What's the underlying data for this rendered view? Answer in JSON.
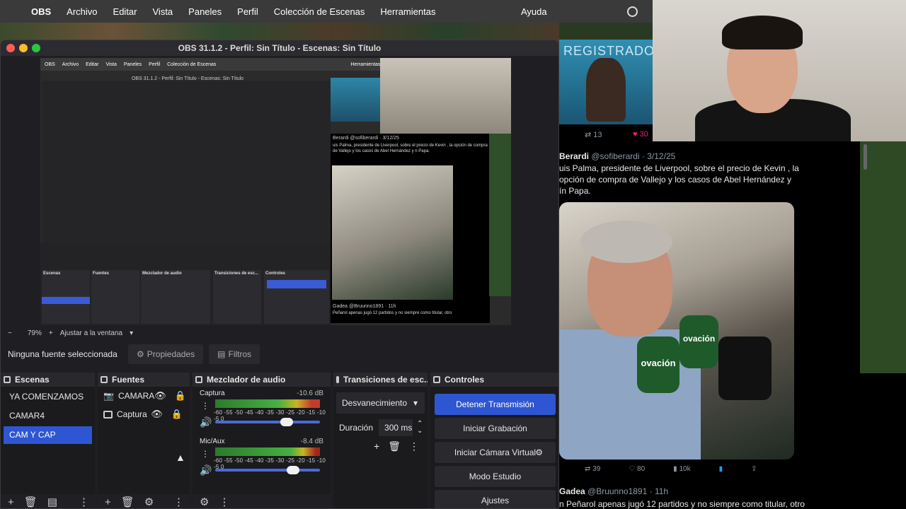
{
  "menubar": {
    "app": "OBS",
    "items": [
      "Archivo",
      "Editar",
      "Vista",
      "Paneles",
      "Perfil",
      "Colección de Escenas",
      "Herramientas"
    ],
    "help": "Ayuda"
  },
  "window": {
    "title": "OBS 31.1.2 - Perfil: Sin Título - Escenas: Sin Título"
  },
  "preview": {
    "menu": [
      "OBS",
      "Archivo",
      "Editar",
      "Vista",
      "Paneles",
      "Perfil",
      "Colección de Escenas",
      "Herramientas",
      "Ayuda"
    ],
    "title": "OBS 31.1.2 - Perfil: Sin Título - Escenas: Sin Título",
    "tweet_name": "Berardi @sofiberardi · 3/12/25",
    "tweet_text": "uis Palma, presidente de Liverpool, sobre el precio de Kevin , la opción de compra de Vallejo y los casos de Abel Hernández y n Papa.",
    "tweet2_name": "Gadea @Bruunno1891 · 11h",
    "tweet2_text": "Peñarol apenas jugó 12 partidos y no siempre como titular, otro",
    "panels": [
      "Escenas",
      "Fuentes",
      "Mezclador de audio",
      "Transiciones de esc...",
      "Controles"
    ]
  },
  "zoom": {
    "minus": "−",
    "value": "79%",
    "plus": "+",
    "fit": "Ajustar a la ventana",
    "caret": "▾"
  },
  "source_bar": {
    "none": "Ninguna fuente seleccionada",
    "properties": "Propiedades",
    "filters": "Filtros"
  },
  "scenes": {
    "header": "Escenas",
    "items": [
      {
        "label": "YA COMENZAMOS"
      },
      {
        "label": "CAMAR4"
      },
      {
        "label": "CAM Y CAP"
      }
    ]
  },
  "sources": {
    "header": "Fuentes",
    "items": [
      {
        "label": "CAMARA"
      },
      {
        "label": "Captura"
      }
    ]
  },
  "mixer": {
    "header": "Mezclador de audio",
    "ticks": "-60 -55 -50 -45 -40 -35 -30 -25 -20 -15 -10 -5 0",
    "channels": [
      {
        "name": "Captura",
        "db": "-10.6 dB",
        "volume": 0.62
      },
      {
        "name": "Mic/Aux",
        "db": "-8.4 dB",
        "volume": 0.68
      }
    ]
  },
  "transitions": {
    "header": "Transiciones de esc...",
    "selected": "Desvanecimiento",
    "duration_label": "Duración",
    "duration_value": "300 ms"
  },
  "controls": {
    "header": "Controles",
    "buttons": [
      {
        "label": "Detener Transmisión"
      },
      {
        "label": "Iniciar Grabación"
      },
      {
        "label": "Iniciar Cámara Virtual"
      },
      {
        "label": "Modo Estudio"
      },
      {
        "label": "Ajustes"
      }
    ]
  },
  "twitter": {
    "tv_text": "REGISTRADO",
    "top_retweets": "13",
    "top_likes": "30",
    "name": "Berardi",
    "handle": "@sofiberardi · 3/12/25",
    "text": "uis Palma, presidente de Liverpool, sobre el precio de Kevin , la opción de compra de Vallejo y los casos de Abel Hernández y ín Papa.",
    "mic_label": "ovación",
    "retweets": "39",
    "likes": "80",
    "views": "10k",
    "name2": "Gadea",
    "handle2": "@Bruunno1891 · 11h",
    "text2": "n Peñarol apenas jugó 12 partidos y no siempre como titular, otro"
  },
  "colors": {
    "accent": "#2f56d2",
    "bg": "#1f1f23"
  }
}
